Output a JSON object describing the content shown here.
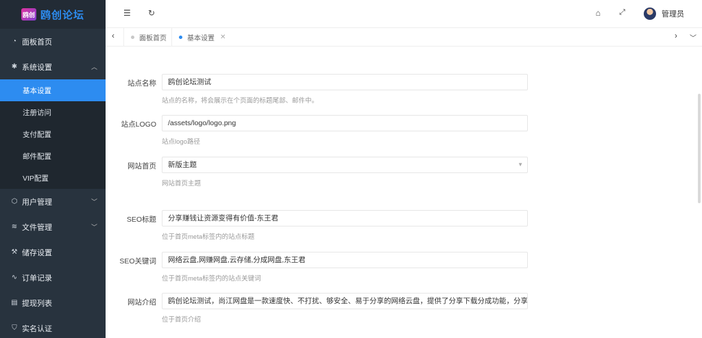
{
  "brand": {
    "logo_text": "鸥创",
    "title": "鸥创论坛"
  },
  "sidebar": {
    "items": [
      {
        "label": "面板首页",
        "icon": "dashboard-icon"
      },
      {
        "label": "系统设置",
        "icon": "gear-icon",
        "expanded": true
      },
      {
        "label": "用户管理",
        "icon": "cube-icon"
      },
      {
        "label": "文件管理",
        "icon": "layers-icon"
      },
      {
        "label": "储存设置",
        "icon": "wrench-icon"
      },
      {
        "label": "订单记录",
        "icon": "activity-icon"
      },
      {
        "label": "提现列表",
        "icon": "list-icon"
      },
      {
        "label": "实名认证",
        "icon": "shield-icon"
      }
    ],
    "submenu": [
      "基本设置",
      "注册访问",
      "支付配置",
      "邮件配置",
      "VIP配置"
    ]
  },
  "topbar": {
    "admin_name": "管理员"
  },
  "tabs": [
    {
      "label": "面板首页",
      "active": false
    },
    {
      "label": "基本设置",
      "active": true
    }
  ],
  "form": {
    "site_name": {
      "label": "站点名称",
      "value": "鸥创论坛测试",
      "help": "站点的名称，将会展示在个页面的标题尾部、邮件中。"
    },
    "site_logo": {
      "label": "站点LOGO",
      "value": "/assets/logo/logo.png",
      "help": "站点logo路径"
    },
    "home": {
      "label": "网站首页",
      "value": "新版主题",
      "help": "网站首页主题"
    },
    "seo_title": {
      "label": "SEO标题",
      "value": "分享赚钱让资源变得有价值-东王君",
      "help": "位于首页meta标签内的站点标题"
    },
    "seo_keywords": {
      "label": "SEO关键词",
      "value": "网络云盘,网赚网盘,云存储,分成网盘,东王君",
      "help": "位于首页meta标签内的站点关键词"
    },
    "intro": {
      "label": "网站介绍",
      "value": "鸥创论坛测试，尚江网盘是一款速度快、不打扰、够安全、易于分享的网络云盘，提供了分享下载分成功能，分享赚钱，让资源变得",
      "help": "位于首页介绍"
    }
  },
  "colors": {
    "sidebar_bg": "#28333e",
    "accent": "#2d8cf0"
  }
}
